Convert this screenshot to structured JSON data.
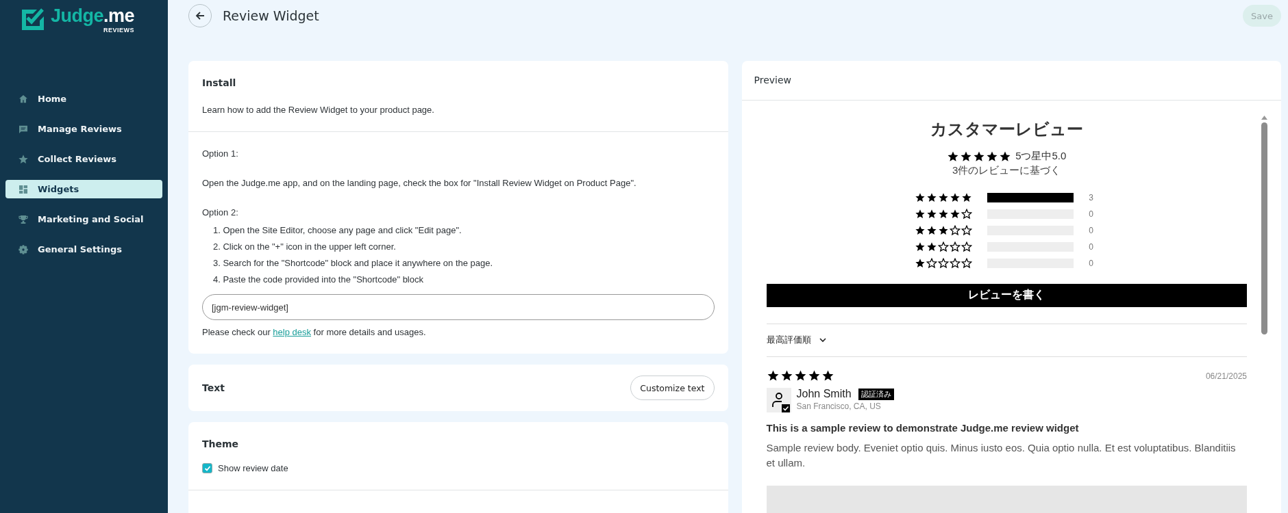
{
  "logo": {
    "name": "Judge",
    "suffix": ".me",
    "tagline": "REVIEWS"
  },
  "sidebar": {
    "items": [
      {
        "label": "Home",
        "kind": "home",
        "selected": false
      },
      {
        "label": "Manage Reviews",
        "kind": "message",
        "selected": false
      },
      {
        "label": "Collect Reviews",
        "kind": "star",
        "selected": false
      },
      {
        "label": "Widgets",
        "kind": "grid",
        "selected": true
      },
      {
        "label": "Marketing and Social",
        "kind": "trophy",
        "selected": false
      },
      {
        "label": "General Settings",
        "kind": "gear",
        "selected": false
      }
    ]
  },
  "header": {
    "title": "Review Widget",
    "save_button": {
      "label": "Save",
      "disabled": true
    }
  },
  "install": {
    "title": "Install",
    "description": "Learn how to add the Review Widget to your product page.",
    "option_1": {
      "label": "Option 1:",
      "text": "Open the Judge.me app, and on the landing page, check the box for \"Install Review Widget on Product Page\"."
    },
    "option_2": {
      "label": "Option 2:",
      "steps": [
        "1. Open the Site Editor, choose any page and click \"Edit page\".",
        "2. Click on the \"+\" icon in the upper left corner.",
        "3. Search for the \"Shortcode\" block and place it anywhere on the page.",
        "4. Paste the code provided into the \"Shortcode\" block"
      ]
    },
    "code_field": {
      "value": "[jgm-review-widget]"
    },
    "help": {
      "before": "Please check our ",
      "link": "help desk",
      "after": " for more details and usages."
    }
  },
  "text_section": {
    "title": "Text",
    "button": "Customize text"
  },
  "theme": {
    "title": "Theme",
    "options": [
      {
        "label": "Show review date",
        "checked": true
      }
    ]
  },
  "preview": {
    "title": "Preview",
    "widget_title": "カスタマーレビュー",
    "summary": {
      "stars": 5,
      "text": "5つ星中5.0",
      "subtitle": "3件のレビューに基づく"
    },
    "histogram": [
      {
        "stars": 5,
        "level": 1,
        "count": "3"
      },
      {
        "stars": 4,
        "level": 0,
        "count": "0"
      },
      {
        "stars": 3,
        "level": 0,
        "count": "0"
      },
      {
        "stars": 2,
        "level": 0,
        "count": "0"
      },
      {
        "stars": 1,
        "level": 0,
        "count": "0"
      }
    ],
    "write_button": "レビューを書く",
    "sort": "最高評価順",
    "review": {
      "stars": 5,
      "date": "06/21/2025",
      "author": "John Smith",
      "badge": "認証済み",
      "location": "San Francisco, CA, US",
      "title": "This is a sample review to demonstrate Judge.me review widget",
      "body": "Sample review body. Eveniet optio quis. Minus iusto eos. Quia optio nulla. Et est voluptatibus. Blanditiis et ullam."
    }
  }
}
